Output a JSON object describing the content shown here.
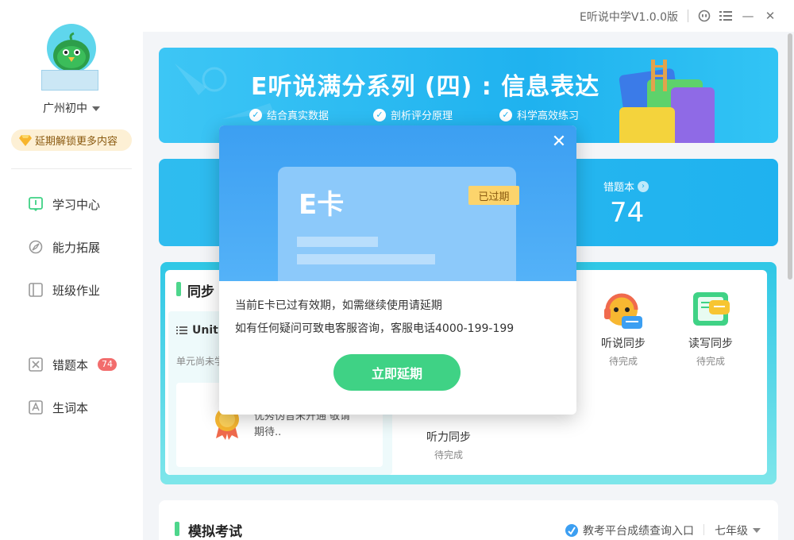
{
  "app": {
    "title": "E听说中学V1.0.0版"
  },
  "window_controls": {
    "support_icon": "headset-icon",
    "menu_icon": "menu-icon",
    "minimize_icon": "minimize-icon",
    "close_icon": "close-icon",
    "minimize_glyph": "—",
    "close_glyph": "✕"
  },
  "sidebar": {
    "school": "广州初中",
    "unlock_text": "延期解锁更多内容",
    "items": [
      {
        "label": "学习中心",
        "icon": "book-icon",
        "active": true
      },
      {
        "label": "能力拓展",
        "icon": "compass-icon"
      },
      {
        "label": "班级作业",
        "icon": "homework-icon"
      },
      {
        "label": "错题本",
        "icon": "wrongbook-icon",
        "badge": "74"
      },
      {
        "label": "生词本",
        "icon": "vocab-icon"
      }
    ]
  },
  "banner": {
    "title": "E听说满分系列 (四) : 信息表达",
    "features": [
      "结合真实数据",
      "剖析评分原理",
      "科学高效练习"
    ],
    "check_glyph": "✓"
  },
  "stats": {
    "wrong_label": "错题本",
    "wrong_count": "74",
    "arrow_glyph": "›"
  },
  "sync": {
    "title_partial": "同步",
    "unit_label": "Unit",
    "unit_hint": "单元尚未学",
    "award_text": "优秀伪音未开通 敬请期待..",
    "tasks": [
      {
        "name": "听说同步",
        "status": "待完成"
      },
      {
        "name": "读写同步",
        "status": "待完成"
      },
      {
        "name": "听力同步",
        "status": "待完成"
      }
    ]
  },
  "mock": {
    "title": "模拟考试",
    "link": "教考平台成绩查询入口",
    "grade": "七年级"
  },
  "modal": {
    "card_title": "E卡",
    "expired_tag": "已过期",
    "line1": "当前E卡已过有效期，如需继续使用请延期",
    "line2": "如有任何疑问可致电客服咨询，客服电话4000-199-199",
    "button": "立即延期",
    "close_glyph": "✕"
  },
  "colors": {
    "accent_green": "#3fd285",
    "banner_blue": "#1fb2ef",
    "modal_blue": "#3c9ff2",
    "badge_red": "#f26d6d"
  }
}
